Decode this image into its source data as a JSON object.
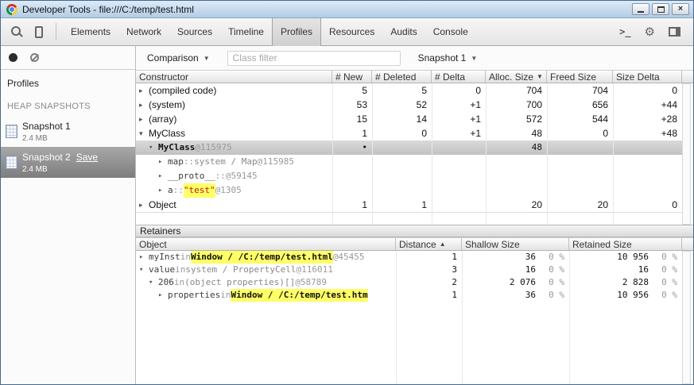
{
  "window": {
    "title": "Developer Tools - file:///C:/temp/test.html"
  },
  "titlebar": {
    "close_glyph": "×"
  },
  "toolbar": {
    "console_glyph": ">_",
    "gear_glyph": "⚙",
    "tabs": [
      {
        "label": "Elements",
        "active": false
      },
      {
        "label": "Network",
        "active": false
      },
      {
        "label": "Sources",
        "active": false
      },
      {
        "label": "Timeline",
        "active": false
      },
      {
        "label": "Profiles",
        "active": true
      },
      {
        "label": "Resources",
        "active": false
      },
      {
        "label": "Audits",
        "active": false
      },
      {
        "label": "Console",
        "active": false
      }
    ]
  },
  "sidebar": {
    "profiles_label": "Profiles",
    "section_heading": "HEAP SNAPSHOTS",
    "snapshots": [
      {
        "name": "Snapshot 1",
        "size": "2.4 MB",
        "selected": false
      },
      {
        "name": "Snapshot 2",
        "size": "2.4 MB",
        "selected": true,
        "save_link": "Save"
      }
    ]
  },
  "controls": {
    "view_mode": "Comparison",
    "class_filter_placeholder": "Class filter",
    "base_snapshot": "Snapshot 1"
  },
  "constructor_table": {
    "columns": [
      {
        "label": "Constructor"
      },
      {
        "label": "# New"
      },
      {
        "label": "# Deleted"
      },
      {
        "label": "# Delta"
      },
      {
        "label": "Alloc. Size",
        "sort": "desc"
      },
      {
        "label": "Freed Size"
      },
      {
        "label": "Size Delta"
      }
    ],
    "rows": [
      {
        "indent": 0,
        "arrow": "collapsed",
        "mono": false,
        "selected": false,
        "segments": [
          {
            "t": "(compiled code)",
            "s": "name"
          }
        ],
        "cells": [
          "5",
          "5",
          "0",
          "704",
          "704",
          "0"
        ]
      },
      {
        "indent": 0,
        "arrow": "collapsed",
        "mono": false,
        "selected": false,
        "segments": [
          {
            "t": "(system)",
            "s": "name"
          }
        ],
        "cells": [
          "53",
          "52",
          "+1",
          "700",
          "656",
          "+44"
        ]
      },
      {
        "indent": 0,
        "arrow": "collapsed",
        "mono": false,
        "selected": false,
        "segments": [
          {
            "t": "(array)",
            "s": "name"
          }
        ],
        "cells": [
          "15",
          "14",
          "+1",
          "572",
          "544",
          "+28"
        ]
      },
      {
        "indent": 0,
        "arrow": "expanded",
        "mono": false,
        "selected": false,
        "segments": [
          {
            "t": "MyClass",
            "s": "name"
          }
        ],
        "cells": [
          "1",
          "0",
          "+1",
          "48",
          "0",
          "+48"
        ]
      },
      {
        "indent": 1,
        "arrow": "expanded",
        "mono": true,
        "selected": true,
        "segments": [
          {
            "t": "MyClass",
            "s": "obj"
          },
          {
            "t": " @115975",
            "s": "addr"
          }
        ],
        "cells": [
          "•",
          "",
          "",
          "48",
          "",
          ""
        ]
      },
      {
        "indent": 2,
        "arrow": "collapsed",
        "mono": true,
        "selected": false,
        "segments": [
          {
            "t": "map",
            "s": "prop"
          },
          {
            "t": " :: ",
            "s": "sep"
          },
          {
            "t": "system / Map",
            "s": "val"
          },
          {
            "t": " @115985",
            "s": "addr"
          }
        ],
        "cells": [
          "",
          "",
          "",
          "",
          "",
          ""
        ]
      },
      {
        "indent": 2,
        "arrow": "collapsed",
        "mono": true,
        "selected": false,
        "segments": [
          {
            "t": "__proto__",
            "s": "prop"
          },
          {
            "t": " :: ",
            "s": "sep"
          },
          {
            "t": "@59145",
            "s": "addr"
          }
        ],
        "cells": [
          "",
          "",
          "",
          "",
          "",
          ""
        ]
      },
      {
        "indent": 2,
        "arrow": "collapsed",
        "mono": true,
        "selected": false,
        "segments": [
          {
            "t": "a",
            "s": "prop"
          },
          {
            "t": " :: ",
            "s": "sep"
          },
          {
            "t": "\"test\"",
            "s": "strhl"
          },
          {
            "t": " @1305",
            "s": "addr"
          }
        ],
        "cells": [
          "",
          "",
          "",
          "",
          "",
          ""
        ]
      },
      {
        "indent": 0,
        "arrow": "collapsed",
        "mono": false,
        "selected": false,
        "segments": [
          {
            "t": "Object",
            "s": "name"
          }
        ],
        "cells": [
          "1",
          "1",
          "",
          "20",
          "20",
          "0"
        ]
      }
    ]
  },
  "retainers": {
    "title": "Retainers",
    "columns": [
      {
        "label": "Object"
      },
      {
        "label": "Distance",
        "sort": "asc"
      },
      {
        "label": "Shallow Size"
      },
      {
        "label": "Retained Size"
      }
    ],
    "rows": [
      {
        "indent": 0,
        "arrow": "collapsed",
        "segments": [
          {
            "t": "myInst",
            "s": "prop"
          },
          {
            "t": " in ",
            "s": "sep"
          },
          {
            "t": "Window / /C:/temp/test.html",
            "s": "hl"
          },
          {
            "t": " @45455",
            "s": "addr"
          }
        ],
        "distance": "1",
        "shallow": "36",
        "shallow_pct": "0 %",
        "retained": "10 956",
        "retained_pct": "0 %"
      },
      {
        "indent": 0,
        "arrow": "expanded",
        "segments": [
          {
            "t": "value",
            "s": "prop"
          },
          {
            "t": " in ",
            "s": "sep"
          },
          {
            "t": "system / PropertyCell",
            "s": "val"
          },
          {
            "t": " @116011",
            "s": "addr"
          }
        ],
        "distance": "3",
        "shallow": "16",
        "shallow_pct": "0 %",
        "retained": "16",
        "retained_pct": "0 %"
      },
      {
        "indent": 1,
        "arrow": "expanded",
        "segments": [
          {
            "t": "206",
            "s": "prop"
          },
          {
            "t": " in ",
            "s": "sep"
          },
          {
            "t": "(object properties)[]",
            "s": "val"
          },
          {
            "t": " @58789",
            "s": "addr"
          }
        ],
        "distance": "2",
        "shallow": "2 076",
        "shallow_pct": "0 %",
        "retained": "2 828",
        "retained_pct": "0 %"
      },
      {
        "indent": 2,
        "arrow": "collapsed",
        "segments": [
          {
            "t": "properties",
            "s": "prop"
          },
          {
            "t": " in ",
            "s": "sep"
          },
          {
            "t": "Window / /C:/temp/test.htm",
            "s": "hl"
          }
        ],
        "distance": "1",
        "shallow": "36",
        "shallow_pct": "0 %",
        "retained": "10 956",
        "retained_pct": "0 %"
      }
    ]
  }
}
